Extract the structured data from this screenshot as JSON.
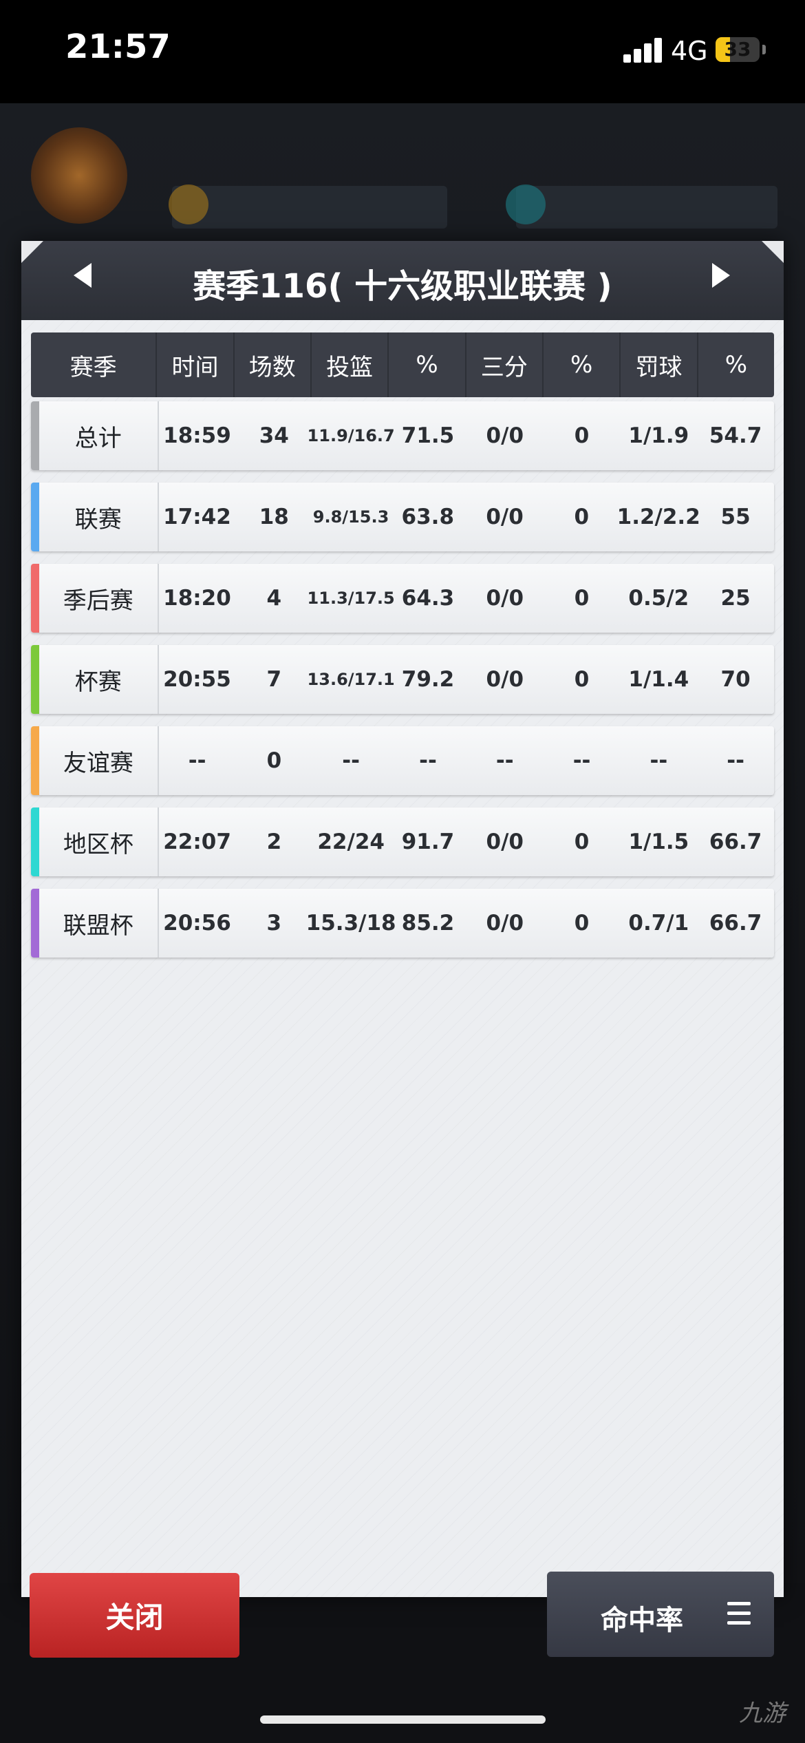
{
  "status_bar": {
    "time": "21:57",
    "network": "4G",
    "battery": "33",
    "battery_level": 0.33
  },
  "modal": {
    "title": "赛季116( 十六级职业联赛 )",
    "columns": [
      "赛季",
      "时间",
      "场数",
      "投篮",
      "%",
      "三分",
      "%",
      "罚球",
      "%"
    ],
    "rows": [
      {
        "name": "总计",
        "color": "#a9abae",
        "cells": [
          "18:59",
          "34",
          "11.9/16.7",
          "71.5",
          "0/0",
          "0",
          "1/1.9",
          "54.7"
        ]
      },
      {
        "name": "联赛",
        "color": "#5aa9f0",
        "cells": [
          "17:42",
          "18",
          "9.8/15.3",
          "63.8",
          "0/0",
          "0",
          "1.2/2.2",
          "55"
        ]
      },
      {
        "name": "季后赛",
        "color": "#f06a6a",
        "cells": [
          "18:20",
          "4",
          "11.3/17.5",
          "64.3",
          "0/0",
          "0",
          "0.5/2",
          "25"
        ]
      },
      {
        "name": "杯赛",
        "color": "#7cc93b",
        "cells": [
          "20:55",
          "7",
          "13.6/17.1",
          "79.2",
          "0/0",
          "0",
          "1/1.4",
          "70"
        ]
      },
      {
        "name": "友谊赛",
        "color": "#f6a94a",
        "cells": [
          "--",
          "0",
          "--",
          "--",
          "--",
          "--",
          "--",
          "--"
        ]
      },
      {
        "name": "地区杯",
        "color": "#2ed8d2",
        "cells": [
          "22:07",
          "2",
          "22/24",
          "91.7",
          "0/0",
          "0",
          "1/1.5",
          "66.7"
        ]
      },
      {
        "name": "联盟杯",
        "color": "#a26ad6",
        "cells": [
          "20:56",
          "3",
          "15.3/18",
          "85.2",
          "0/0",
          "0",
          "0.7/1",
          "66.7"
        ]
      }
    ],
    "close_label": "关闭",
    "rate_label": "命中率",
    "menu_icon": "menu-icon"
  },
  "watermark": "九游"
}
